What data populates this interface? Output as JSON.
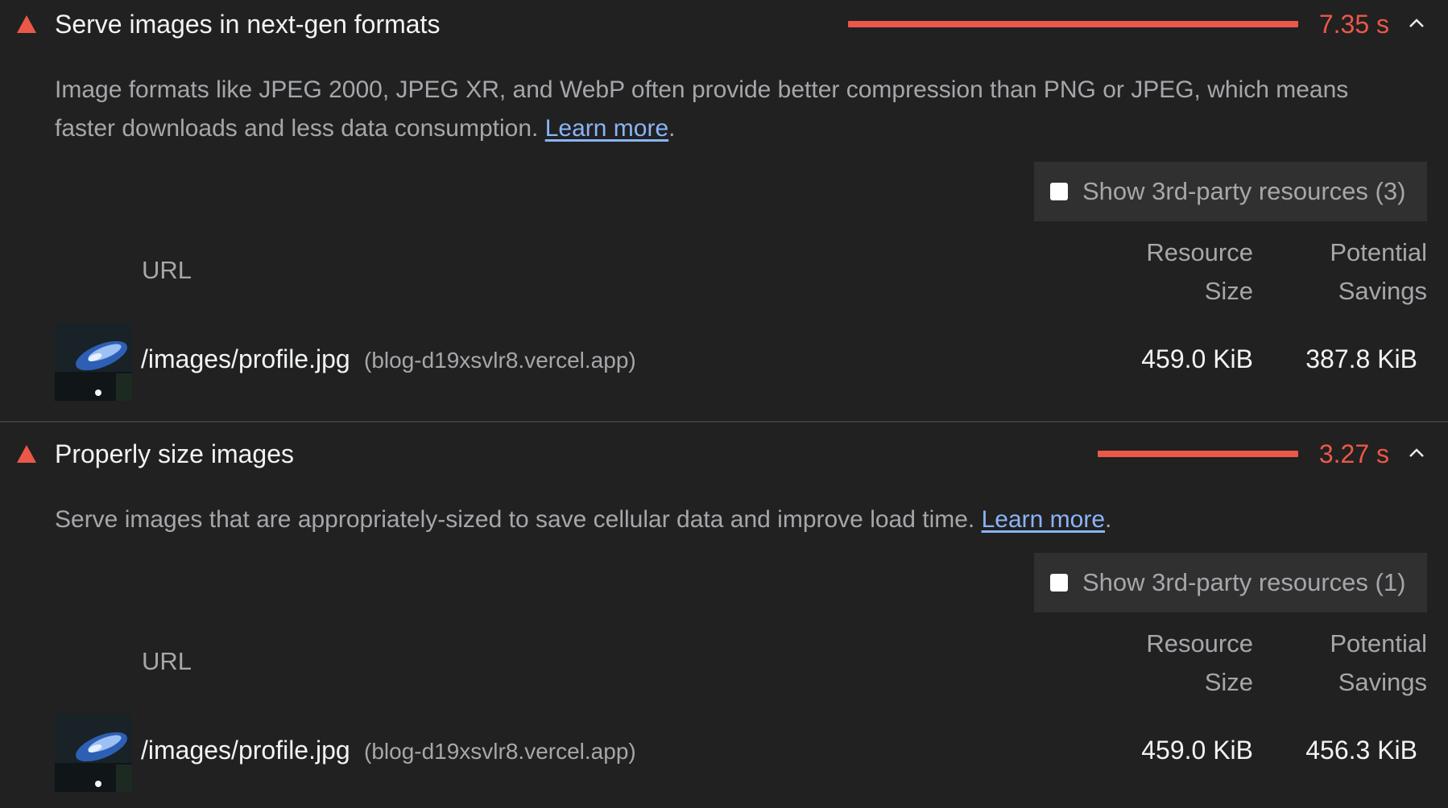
{
  "colors": {
    "background": "#212121",
    "warning": "#eb5849",
    "link": "#8ab4f8",
    "muted_text": "#a5a7aa",
    "primary_text": "#f1f3f4",
    "panel": "#303030"
  },
  "audits": [
    {
      "icon": "warning-triangle-icon",
      "title": "Serve images in next-gen formats",
      "savings_time": "7.35 s",
      "savings_seconds": 7.35,
      "expanded": true,
      "description": "Image formats like JPEG 2000, JPEG XR, and WebP often provide better compression than PNG or JPEG, which means faster downloads and less data consumption.",
      "learn_more": "Learn more",
      "trailing_period": ".",
      "third_party_label": "Show 3rd-party resources (3)",
      "third_party_checked": false,
      "columns": {
        "url": "URL",
        "resource_size_1": "Resource",
        "resource_size_2": "Size",
        "potential_savings_1": "Potential",
        "potential_savings_2": "Savings"
      },
      "rows": [
        {
          "path": "/images/profile.jpg",
          "host": "(blog-d19xsvlr8.vercel.app)",
          "resource_size": "459.0 KiB",
          "potential_savings": "387.8 KiB"
        }
      ]
    },
    {
      "icon": "warning-triangle-icon",
      "title": "Properly size images",
      "savings_time": "3.27 s",
      "savings_seconds": 3.27,
      "expanded": true,
      "description": "Serve images that are appropriately-sized to save cellular data and improve load time.",
      "learn_more": "Learn more",
      "trailing_period": ".",
      "third_party_label": "Show 3rd-party resources (1)",
      "third_party_checked": false,
      "columns": {
        "url": "URL",
        "resource_size_1": "Resource",
        "resource_size_2": "Size",
        "potential_savings_1": "Potential",
        "potential_savings_2": "Savings"
      },
      "rows": [
        {
          "path": "/images/profile.jpg",
          "host": "(blog-d19xsvlr8.vercel.app)",
          "resource_size": "459.0 KiB",
          "potential_savings": "456.3 KiB"
        }
      ]
    }
  ]
}
